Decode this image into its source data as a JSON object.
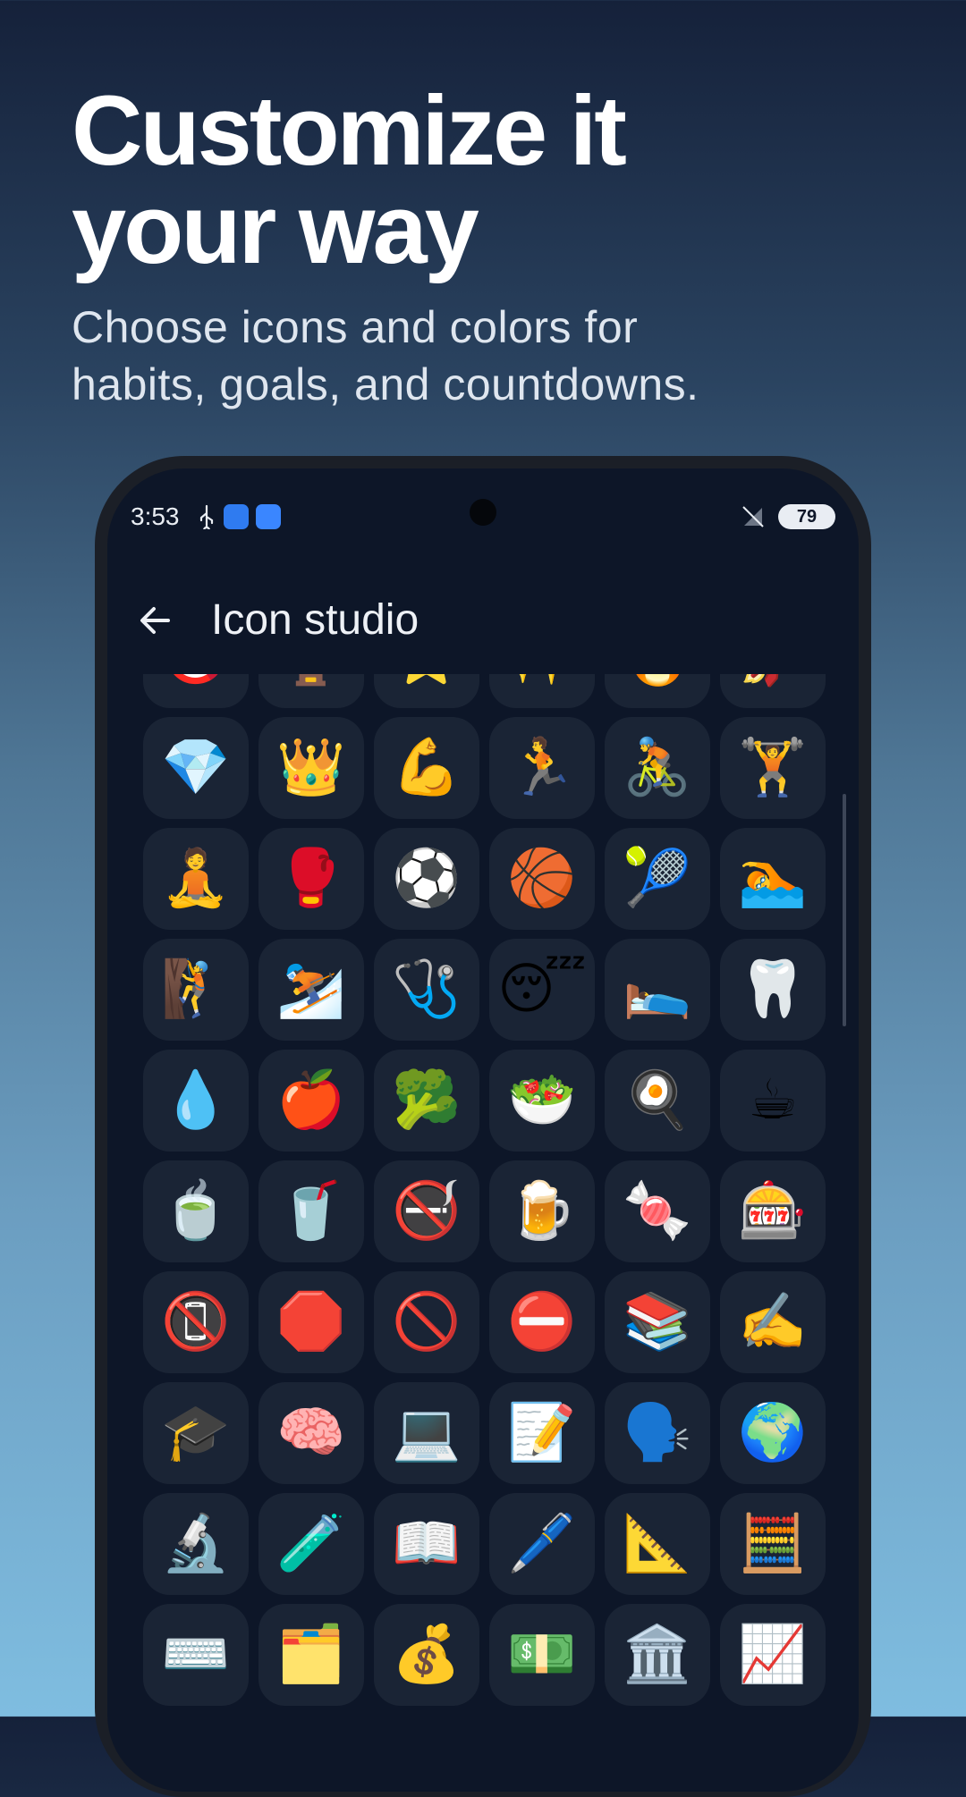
{
  "promo": {
    "headline_line1": "Customize it",
    "headline_line2": "your way",
    "subline_line1": "Choose icons and colors for",
    "subline_line2": "habits, goals, and countdowns."
  },
  "status_bar": {
    "time": "3:53",
    "battery": "79",
    "icons": [
      "usb-icon",
      "app-notification-icon",
      "app-notification-icon",
      "no-signal-icon",
      "battery-icon"
    ]
  },
  "app_bar": {
    "title": "Icon studio",
    "back_icon": "back-arrow-icon"
  },
  "colors": {
    "screen_bg": "#0d1628",
    "tile_bg": "#1a2435",
    "text": "#eef1f6"
  },
  "icon_grid": [
    [
      "🎯",
      "🏆",
      "⭐",
      "✨",
      "🔥",
      "🚀"
    ],
    [
      "💎",
      "👑",
      "💪",
      "🏃",
      "🚴",
      "🏋️"
    ],
    [
      "🧘",
      "🥊",
      "⚽",
      "🏀",
      "🎾",
      "🏊"
    ],
    [
      "🧗",
      "⛷️",
      "🩺",
      "😴",
      "🛌",
      "🦷"
    ],
    [
      "💧",
      "🍎",
      "🥦",
      "🥗",
      "🍳",
      "☕"
    ],
    [
      "🍵",
      "🥤",
      "🚭",
      "🍺",
      "🍬",
      "🎰"
    ],
    [
      "📵",
      "🛑",
      "🚫",
      "⛔",
      "📚",
      "✍️"
    ],
    [
      "🎓",
      "🧠",
      "💻",
      "📝",
      "🗣️",
      "🌍"
    ],
    [
      "🔬",
      "🧪",
      "📖",
      "🖊️",
      "📐",
      "🧮"
    ],
    [
      "⌨️",
      "🗂️",
      "💰",
      "💵",
      "🏛️",
      "📈"
    ]
  ]
}
